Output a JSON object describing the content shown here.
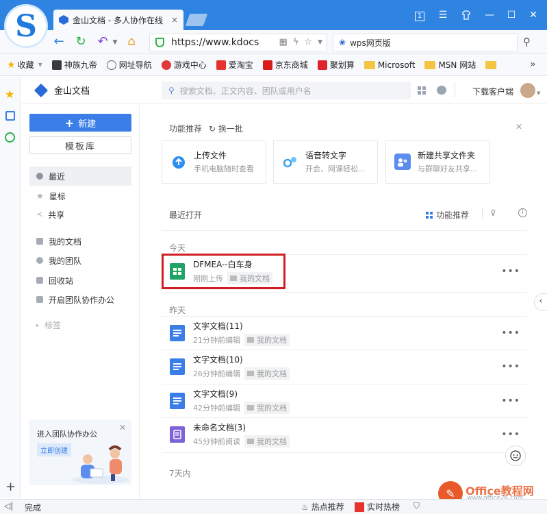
{
  "browser": {
    "tab_title": "金山文档 - 多人协作在线",
    "tab_close": "×",
    "url": "https://www.kdocs",
    "search_engine_text": "wps网页版",
    "win_buttons": [
      "1",
      "☰",
      "👕",
      "—",
      "☐",
      "✕"
    ]
  },
  "bookmarks": [
    {
      "label": "收藏",
      "color": "#f5b400"
    },
    {
      "label": "神族九帝",
      "color": "#3a3a3a"
    },
    {
      "label": "网址导航",
      "color": "#666666"
    },
    {
      "label": "游戏中心",
      "color": "#e03a3a"
    },
    {
      "label": "爱淘宝",
      "color": "#e8322f"
    },
    {
      "label": "京东商城",
      "color": "#d71b1b"
    },
    {
      "label": "聚划算",
      "color": "#e0222f"
    },
    {
      "label": "Microsoft",
      "color": "folder"
    },
    {
      "label": "MSN 网站",
      "color": "folder"
    }
  ],
  "app": {
    "brand": "金山文档",
    "search_placeholder": "搜索文档、正文内容、团队或用户名",
    "download_client": "下载客户端"
  },
  "sidebar": {
    "new_button": "新建",
    "template_button": "模板库",
    "nav": [
      {
        "label": "最近"
      },
      {
        "label": "星标"
      },
      {
        "label": "共享"
      },
      {
        "label": "我的文档"
      },
      {
        "label": "我的团队"
      },
      {
        "label": "回收站"
      },
      {
        "label": "开启团队协作办公"
      }
    ],
    "tags": "标签",
    "promo_title": "进入团队协作办公",
    "promo_button": "立即创建"
  },
  "features": {
    "heading": "功能推荐",
    "refresh": "换一批",
    "cards": [
      {
        "title": "上传文件",
        "desc": "手机电脑随时查看",
        "color": "#2f8ff0"
      },
      {
        "title": "语音转文字",
        "desc": "开会、网课轻松...",
        "color": "#3aa0f0"
      },
      {
        "title": "新建共享文件夹",
        "desc": "与群聊好友共享...",
        "color": "#5b8def"
      }
    ]
  },
  "recent": {
    "heading": "最近打开",
    "feature_toggle": "功能推荐",
    "groups": [
      {
        "label": "今天"
      },
      {
        "label": "昨天"
      },
      {
        "label": "7天内"
      }
    ],
    "files": [
      {
        "name": "DFMEA--白车身",
        "time": "刚刚上传",
        "folder": "我的文档",
        "type": "sheet",
        "color": "#1fa463"
      },
      {
        "name": "文字文档(11)",
        "time": "21分钟前编辑",
        "folder": "我的文档",
        "type": "doc",
        "color": "#3b7ee8"
      },
      {
        "name": "文字文档(10)",
        "time": "26分钟前编辑",
        "folder": "我的文档",
        "type": "doc",
        "color": "#3b7ee8"
      },
      {
        "name": "文字文档(9)",
        "time": "42分钟前编辑",
        "folder": "我的文档",
        "type": "doc",
        "color": "#3b7ee8"
      },
      {
        "name": "未命名文档(3)",
        "time": "45分钟前阅读",
        "folder": "我的文档",
        "type": "note",
        "color": "#7d63d8"
      }
    ],
    "more": "•••"
  },
  "status": {
    "left": "完成",
    "hot_recommend": "热点推荐",
    "realtime_hot": "实时热榜"
  },
  "watermark": {
    "line1": "Office教程网",
    "line2": "www.office26.com"
  }
}
